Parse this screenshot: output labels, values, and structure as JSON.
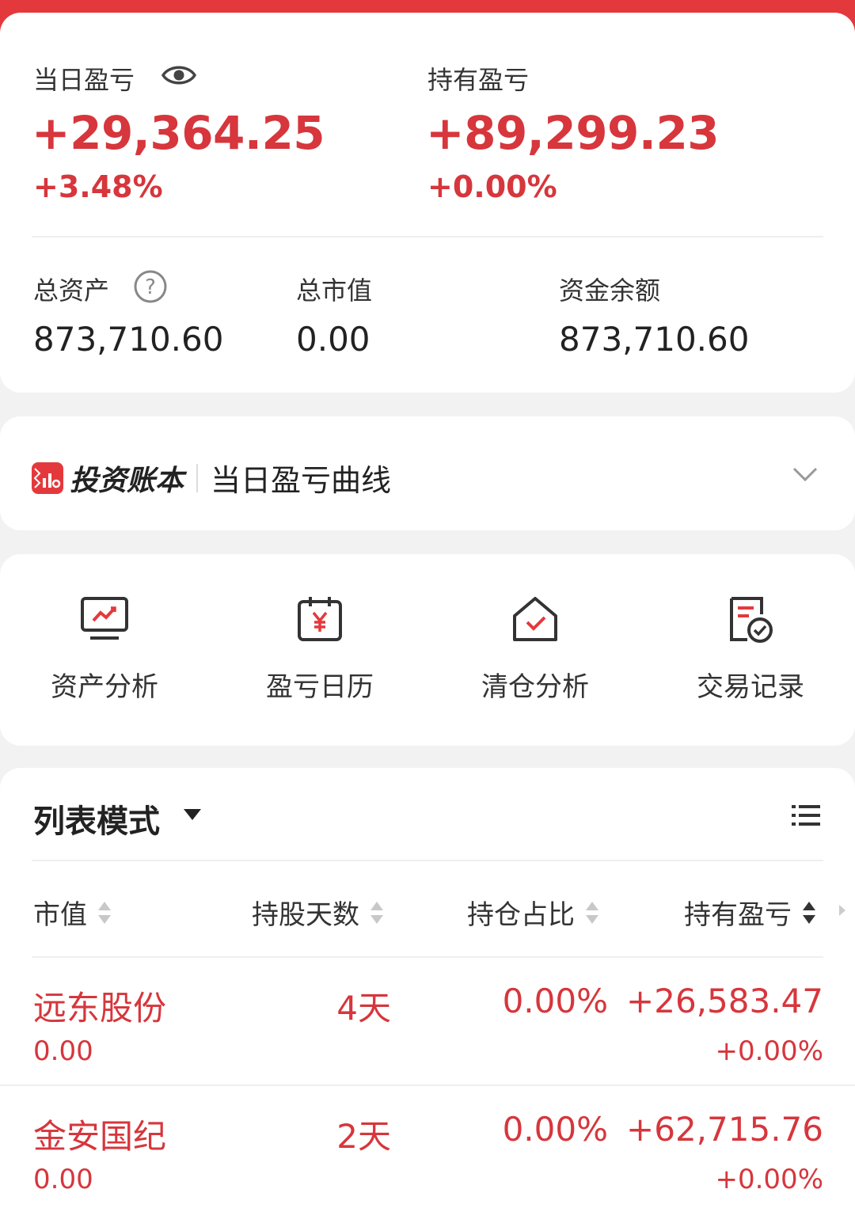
{
  "summary": {
    "daily_pnl_label": "当日盈亏",
    "daily_pnl_value": "+29,364.25",
    "daily_pnl_pct": "+3.48%",
    "holding_pnl_label": "持有盈亏",
    "holding_pnl_value": "+89,299.23",
    "holding_pnl_pct": "+0.00%",
    "total_assets_label": "总资产",
    "total_assets_value": "873,710.60",
    "market_value_label": "总市值",
    "market_value_value": "0.00",
    "cash_balance_label": "资金余额",
    "cash_balance_value": "873,710.60"
  },
  "banner": {
    "brand": "投资账本",
    "subtitle": "当日盈亏曲线"
  },
  "tools": [
    {
      "label": "资产分析",
      "icon": "monitor-chart-icon"
    },
    {
      "label": "盈亏日历",
      "icon": "yen-calendar-icon"
    },
    {
      "label": "清仓分析",
      "icon": "house-check-icon"
    },
    {
      "label": "交易记录",
      "icon": "document-check-icon"
    }
  ],
  "list": {
    "mode_label": "列表模式",
    "columns": [
      "市值",
      "持股天数",
      "持仓占比",
      "持有盈亏"
    ],
    "rows": [
      {
        "name": "远东股份",
        "market_value": "0.00",
        "days": "4天",
        "ratio": "0.00%",
        "pnl": "+26,583.47",
        "pnl_pct": "+0.00%"
      },
      {
        "name": "金安国纪",
        "market_value": "0.00",
        "days": "2天",
        "ratio": "0.00%",
        "pnl": "+62,715.76",
        "pnl_pct": "+0.00%"
      }
    ]
  },
  "colors": {
    "accent": "#e4393c",
    "profit_red": "#d6363c"
  }
}
